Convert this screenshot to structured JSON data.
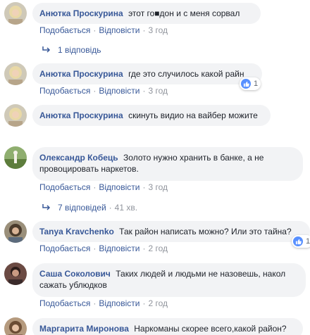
{
  "colors": {
    "author": "#385898",
    "bubble": "#f2f3f5",
    "meta": "#90949c",
    "like": "#5890ff"
  },
  "actions": {
    "like": "Подобається",
    "reply": "Відповісти",
    "separator": "·"
  },
  "comments": [
    {
      "author": "Анютка Проскурина",
      "text": "этот го■дон и с меня сорвал",
      "time": "3 год",
      "replies": "1 відповідь",
      "avatar_icon": "avatar-woman-blonde-icon"
    },
    {
      "author": "Анютка Проскурина",
      "text": "где это случилось какой райн",
      "time": "3 год",
      "reactions": "1",
      "avatar_icon": "avatar-woman-blonde-icon"
    },
    {
      "author": "Анютка Проскурина",
      "text": "скинуть видио на вайбер можите",
      "time": "3 год",
      "avatar_icon": "avatar-woman-blonde-icon"
    },
    {
      "author": "Олександр Кобець",
      "text": "Золото нужно хранить в банке, а не провоцировать наркетов.",
      "time": "3 год",
      "replies": "7 відповідей",
      "replies_meta": "41 хв.",
      "avatar_icon": "avatar-landscape-icon"
    },
    {
      "author": "Tanya Kravchenko",
      "text": "Так район написать можно? Или это тайна?",
      "time": "2 год",
      "reactions": "1",
      "avatar_icon": "avatar-woman-dark-icon"
    },
    {
      "author": "Саша Соколович",
      "text": "Таких людей и людьми не назовешь, накол сажать ублюдков",
      "time": "2 год",
      "avatar_icon": "avatar-man-icon"
    },
    {
      "author": "Маргарита Миронова",
      "text": "Наркоманы скорее всего,какой район?",
      "avatar_icon": "avatar-woman-icon"
    }
  ]
}
